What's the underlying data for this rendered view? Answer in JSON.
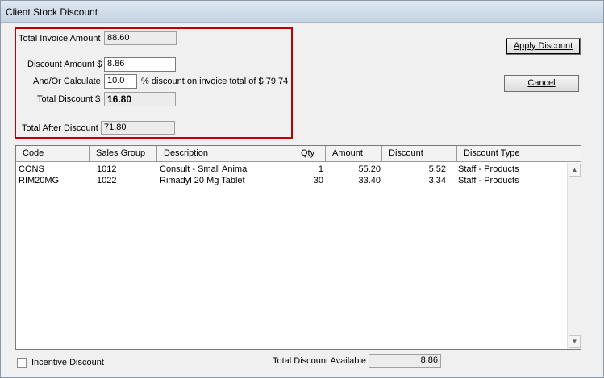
{
  "window": {
    "title": "Client Stock Discount"
  },
  "summary": {
    "total_invoice_label": "Total Invoice Amount",
    "total_invoice_value": "88.60",
    "discount_amount_label": "Discount Amount $",
    "discount_amount_value": "8.86",
    "calculate_label": "And/Or Calculate",
    "calculate_value": "10.0",
    "calculate_suffix": "% discount on invoice total of $ 79.74",
    "total_discount_label": "Total Discount $",
    "total_discount_value": "16.80",
    "total_after_label": "Total After Discount",
    "total_after_value": "71.80"
  },
  "buttons": {
    "apply_label": "Apply Discount",
    "cancel_label": "Cancel"
  },
  "grid": {
    "columns": [
      "Code",
      "Sales Group",
      "Description",
      "Qty",
      "Amount",
      "Discount",
      "Discount Type"
    ],
    "rows": [
      {
        "code": "CONS",
        "sales_group": "1012",
        "description": "Consult - Small Animal",
        "qty": "1",
        "amount": "55.20",
        "discount": "5.52",
        "discount_type": "Staff - Products"
      },
      {
        "code": "RIM20MG",
        "sales_group": "1022",
        "description": "Rimadyl 20 Mg Tablet",
        "qty": "30",
        "amount": "33.40",
        "discount": "3.34",
        "discount_type": "Staff - Products"
      }
    ]
  },
  "footer": {
    "incentive_label": "Incentive Discount",
    "incentive_checked": false,
    "available_label": "Total Discount Available",
    "available_value": "8.86"
  },
  "colors": {
    "highlight_border": "#c00000",
    "window_bg": "#f0f0f0"
  }
}
